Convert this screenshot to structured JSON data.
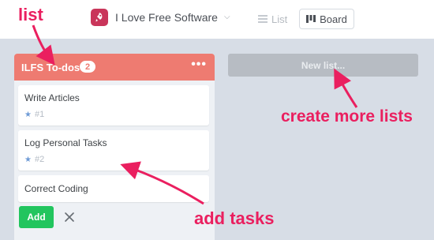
{
  "header": {
    "board_title": "I Love Free Software",
    "view_list_label": "List",
    "view_board_label": "Board"
  },
  "list": {
    "name": "ILFS To-dos",
    "count": "2",
    "cards": [
      {
        "title": "Write Articles",
        "id": "#1"
      },
      {
        "title": "Log Personal Tasks",
        "id": "#2"
      },
      {
        "title": "Correct Coding"
      }
    ],
    "add_label": "Add"
  },
  "new_list_placeholder": "New list...",
  "annotations": {
    "list": "list",
    "create": "create more lists",
    "add": "add tasks"
  },
  "colors": {
    "list_header": "#ee7b71",
    "add_button": "#22c55e",
    "annotation": "#ea1f5f",
    "canvas": "#d7dde6"
  }
}
